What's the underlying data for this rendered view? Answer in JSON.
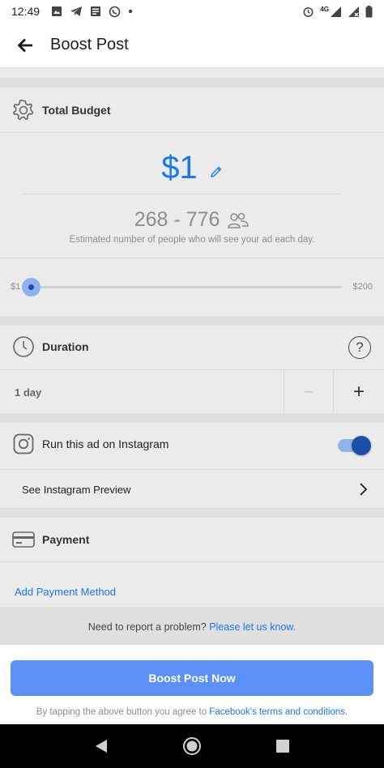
{
  "status_bar": {
    "time": "12:49",
    "network": "4G"
  },
  "app_bar": {
    "title": "Boost Post"
  },
  "budget": {
    "section_title": "Total Budget",
    "amount": "$1",
    "reach": "268 - 776",
    "reach_caption": "Estimated number of people who will see your ad each day.",
    "slider_min": "$1",
    "slider_max": "$200",
    "slider_fraction": 0.0
  },
  "duration": {
    "section_title": "Duration",
    "help_label": "?",
    "value": "1 day",
    "decrement_label": "−",
    "increment_label": "+"
  },
  "instagram": {
    "label": "Run this ad on Instagram",
    "enabled": true,
    "preview_label": "See Instagram Preview"
  },
  "payment": {
    "section_title": "Payment",
    "add_method_label": "Add Payment Method"
  },
  "report": {
    "text": "Need to report a problem?",
    "link": "Please let us know."
  },
  "footer": {
    "button_label": "Boost Post Now",
    "terms_prefix": "By tapping the above button you agree to",
    "terms_link": "Facebook's terms and conditions."
  },
  "colors": {
    "accent": "#1877f2",
    "button": "#5b91f7",
    "toggle_knob": "#1b4fa8"
  }
}
